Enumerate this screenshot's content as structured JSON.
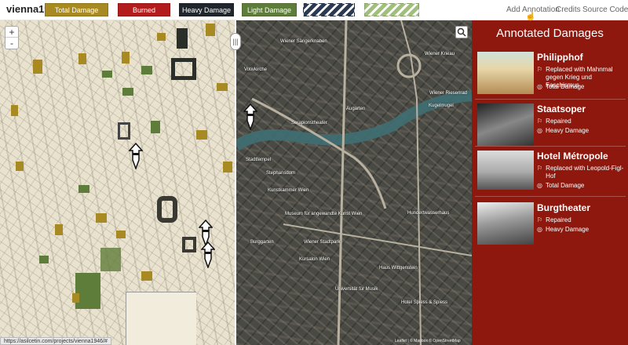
{
  "app": {
    "title": "vienna1946"
  },
  "legend": [
    {
      "label": "Total Damage",
      "color": "#a88a22"
    },
    {
      "label": "Burned",
      "color": "#b31c1c"
    },
    {
      "label": "Heavy Damage",
      "color": "#20262b"
    },
    {
      "label": "Light Damage",
      "color": "#5f7d3a"
    },
    {
      "label": "",
      "color": "#2a3a52"
    },
    {
      "label": "",
      "color": "#9fbf7a"
    }
  ],
  "nav": {
    "add_annotation": "Add Annotation",
    "credits": "Credits",
    "source_code": "Source Code"
  },
  "map": {
    "zoom_in": "+",
    "zoom_out": "-",
    "splitter_icon": "|||",
    "attribution": "Leaflet | © Mapbox © OpenStreetMap",
    "labels": {
      "l1": "Wiener Sängerknaben",
      "l2": "Wiener Riesenrad",
      "l3": "Serapionstheater",
      "l4": "Stadttempel",
      "l5": "Stephansdom",
      "l6": "Kunstkammer Wien",
      "l7": "Museum für angewandte Kunst Wien",
      "l8": "Kursalon Wien",
      "l9": "Hundertwasserhaus",
      "l10": "Haus Wittgenstein",
      "l11": "Universität für Musik",
      "l12": "Hotel Spiess & Spiess",
      "l13": "Wiener Stadtpark",
      "l14": "Kugelmugel",
      "l15": "Wiener Krieau",
      "l16": "Augarten",
      "l17": "Votivkirche",
      "l18": "Burggarten"
    }
  },
  "sidebar": {
    "title": "Annotated Damages",
    "items": [
      {
        "name": "Philipphof",
        "note": "Replaced with Mahnmal gegen Krieg und Faschismus",
        "damage": "Total Damage",
        "note_icon": "flag-icon",
        "damage_icon": "target-icon"
      },
      {
        "name": "Staatsoper",
        "note": "Repaired",
        "damage": "Heavy Damage",
        "note_icon": "flag-icon",
        "damage_icon": "target-icon"
      },
      {
        "name": "Hotel Métropole",
        "note": "Replaced with Leopold-Figl-Hof",
        "damage": "Total Damage",
        "note_icon": "flag-icon",
        "damage_icon": "target-icon"
      },
      {
        "name": "Burgtheater",
        "note": "Repaired",
        "damage": "Heavy Damage",
        "note_icon": "flag-icon",
        "damage_icon": "target-icon"
      }
    ]
  },
  "status_bar": {
    "url": "https://asilcetin.com/projects/vienna1946/#"
  }
}
